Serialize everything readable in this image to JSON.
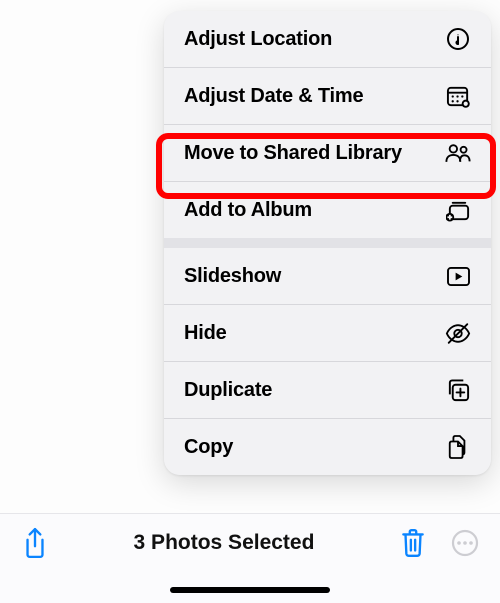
{
  "menu": {
    "items": [
      {
        "label": "Adjust Location"
      },
      {
        "label": "Adjust Date & Time"
      },
      {
        "label": "Move to Shared Library"
      },
      {
        "label": "Add to Album"
      },
      {
        "label": "Slideshow"
      },
      {
        "label": "Hide"
      },
      {
        "label": "Duplicate"
      },
      {
        "label": "Copy"
      }
    ],
    "highlighted_index": 2
  },
  "toolbar": {
    "title": "3 Photos Selected"
  }
}
